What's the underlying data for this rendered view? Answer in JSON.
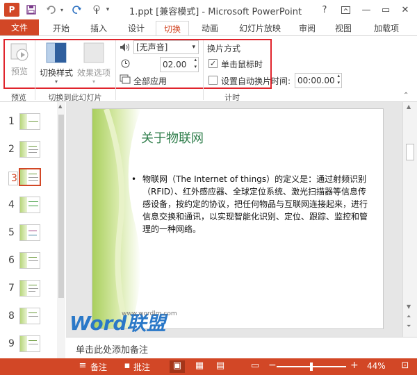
{
  "window": {
    "title": "1.ppt [兼容模式] - Microsoft PowerPoint",
    "logo": "P",
    "help": "?",
    "minimize": "—",
    "restore": "▭",
    "close": "✕"
  },
  "quick_access": {
    "save_icon": "save-icon",
    "undo_icon": "undo-icon",
    "redo_icon": "redo-icon",
    "touch_icon": "touch-mode-icon"
  },
  "tabs": [
    "文件",
    "开始",
    "插入",
    "设计",
    "切换",
    "动画",
    "幻灯片放映",
    "审阅",
    "视图",
    "加载项"
  ],
  "ribbon": {
    "preview_label": "预览",
    "transition_style_label": "切换样式",
    "effect_options_label": "效果选项",
    "sound_value": "[无声音]",
    "duration_value": "02.00",
    "apply_all_label": "全部应用",
    "advance_header": "换片方式",
    "on_click_label": "单击鼠标时",
    "on_click_checked": true,
    "auto_advance_label": "设置自动换片时间:",
    "auto_advance_checked": false,
    "auto_advance_value": "00:00.00",
    "groups": {
      "preview": "预览",
      "transition": "切换到此幻灯片",
      "timing": "计时"
    }
  },
  "thumbnails": {
    "numbers": [
      "1",
      "2",
      "3",
      "4",
      "5",
      "6",
      "7",
      "8",
      "9"
    ],
    "selected_index": 2
  },
  "slide": {
    "title": "关于物联网",
    "bullet": "•",
    "body": "物联网（The Internet of things）的定义是：通过射频识别（RFID）、红外感应器、全球定位系统、激光扫描器等信息传感设备，按约定的协议，把任何物品与互联网连接起来，进行信息交换和通讯，以实现智能化识别、定位、跟踪、监控和管理的一种网络。"
  },
  "notes_placeholder": "单击此处添加备注",
  "watermark": {
    "brand": "Word联盟",
    "url": "www.wordlm.com"
  },
  "statusbar": {
    "notes_label": "备注",
    "comments_label": "批注",
    "zoom_minus": "−",
    "zoom_plus": "+",
    "zoom_value": "44%",
    "zoom_fraction": 0.44
  },
  "colors": {
    "accent": "#d24726",
    "highlight": "#e0242c",
    "title_green": "#2e7d4a"
  }
}
